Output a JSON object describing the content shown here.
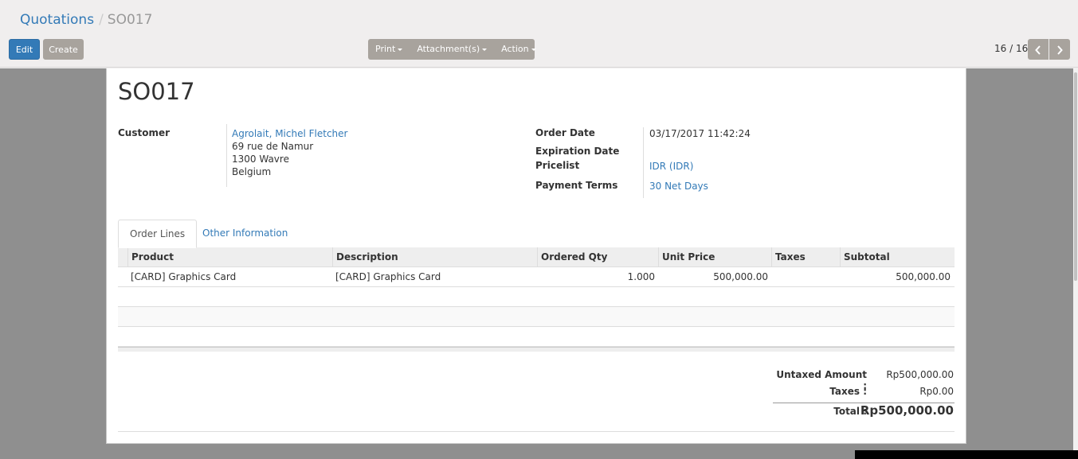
{
  "breadcrumb": {
    "parent": "Quotations",
    "separator": "/",
    "current": "SO017"
  },
  "buttons": {
    "edit": "Edit",
    "create": "Create"
  },
  "sidebar": {
    "print": "Print",
    "attachments": "Attachment(s)",
    "action": "Action"
  },
  "pager": {
    "value": "16 / 16"
  },
  "record": {
    "name": "SO017",
    "customer_label": "Customer",
    "customer_name": "Agrolait, Michel Fletcher",
    "address_line1": "69 rue de Namur",
    "address_line2": "1300 Wavre",
    "address_line3": "Belgium",
    "order_date_label": "Order Date",
    "order_date": "03/17/2017 11:42:24",
    "expiration_label": "Expiration Date",
    "expiration": "",
    "pricelist_label": "Pricelist",
    "pricelist": "IDR (IDR)",
    "payment_terms_label": "Payment Terms",
    "payment_terms": "30 Net Days"
  },
  "tabs": {
    "order_lines": "Order Lines",
    "other_info": "Other Information"
  },
  "order_lines": {
    "columns": [
      "Product",
      "Description",
      "Ordered Qty",
      "Unit Price",
      "Taxes",
      "Subtotal"
    ],
    "rows": [
      {
        "product": "[CARD] Graphics Card",
        "description": "[CARD] Graphics Card",
        "qty": "1.000",
        "unit_price": "500,000.00",
        "taxes": "",
        "subtotal": "500,000.00"
      }
    ]
  },
  "totals": {
    "untaxed_label": "Untaxed Amount :",
    "untaxed": "Rp500,000.00",
    "taxes_label": "Taxes :",
    "taxes": "Rp0.00",
    "total_label": "Total :",
    "total": "Rp500,000.00"
  },
  "colors": {
    "primary": "#337ab7",
    "secondary": "#a8a39d",
    "backdrop": "#8f8f8f"
  },
  "icons": {
    "pager_prev": "chevron-left-icon",
    "pager_next": "chevron-right-icon",
    "dropdown": "caret-down-icon"
  }
}
